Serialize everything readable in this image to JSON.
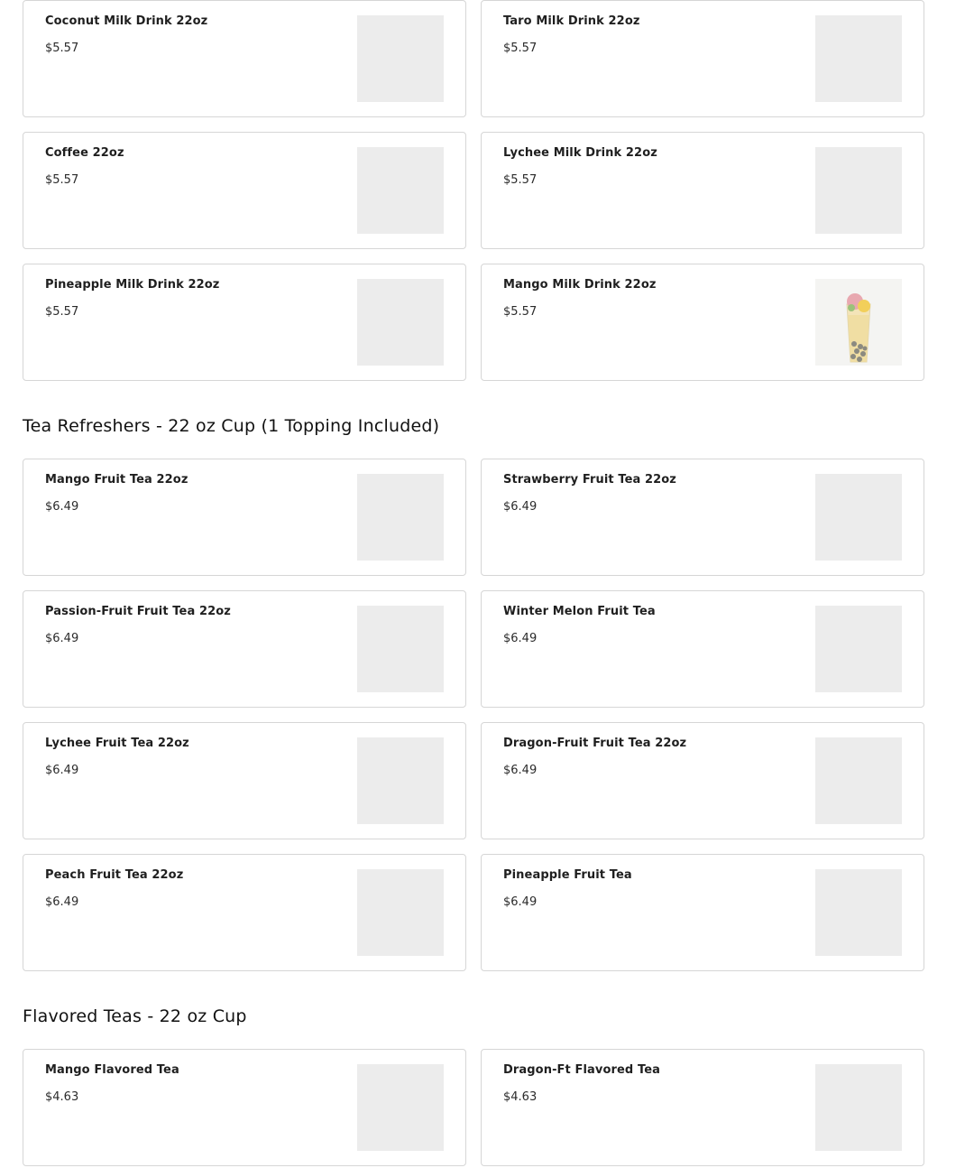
{
  "sections": [
    {
      "title": "",
      "items": [
        {
          "name": "Coconut Milk Drink 22oz",
          "price": "$5.57"
        },
        {
          "name": "Taro Milk Drink 22oz",
          "price": "$5.57"
        },
        {
          "name": "Coffee 22oz",
          "price": "$5.57"
        },
        {
          "name": "Lychee Milk Drink 22oz",
          "price": "$5.57"
        },
        {
          "name": "Pineapple Milk Drink 22oz",
          "price": "$5.57"
        },
        {
          "name": "Mango Milk Drink 22oz",
          "price": "$5.57"
        }
      ]
    },
    {
      "title": "Tea Refreshers - 22 oz Cup (1 Topping Included)",
      "items": [
        {
          "name": "Mango Fruit Tea 22oz",
          "price": "$6.49"
        },
        {
          "name": "Strawberry Fruit Tea 22oz",
          "price": "$6.49"
        },
        {
          "name": "Passion-Fruit Fruit Tea 22oz",
          "price": "$6.49"
        },
        {
          "name": "Winter Melon Fruit Tea",
          "price": "$6.49"
        },
        {
          "name": "Lychee Fruit Tea 22oz",
          "price": "$6.49"
        },
        {
          "name": "Dragon-Fruit Fruit Tea 22oz",
          "price": "$6.49"
        },
        {
          "name": "Peach Fruit Tea 22oz",
          "price": "$6.49"
        },
        {
          "name": "Pineapple Fruit Tea",
          "price": "$6.49"
        }
      ]
    },
    {
      "title": "Flavored Teas - 22 oz Cup",
      "items": [
        {
          "name": "Mango Flavored Tea",
          "price": "$4.63"
        },
        {
          "name": "Dragon-Ft Flavored Tea",
          "price": "$4.63"
        }
      ]
    }
  ],
  "colors": {
    "card_border": "#d6d6d6",
    "placeholder": "#ececec",
    "text": "#1f1f1f"
  }
}
